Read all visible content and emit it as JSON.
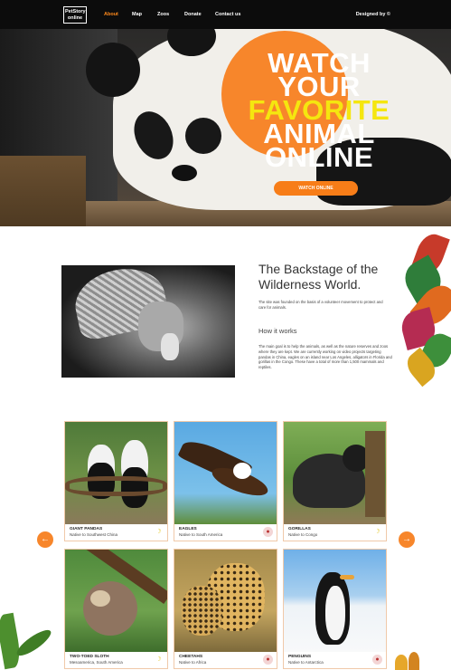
{
  "nav": {
    "logo_line1": "PetStory",
    "logo_line2": "online",
    "links": [
      "About",
      "Map",
      "Zoos",
      "Donate",
      "Contact us"
    ],
    "active": "About",
    "designed_by": "Designed by ©"
  },
  "hero": {
    "line1": "WATCH",
    "line2": "YOUR",
    "line3": "FAVORITE",
    "line4": "ANIMAL",
    "line5": "ONLINE",
    "button": "WATCH ONLINE"
  },
  "about": {
    "title": "The Backstage of the Wilderness World.",
    "text": "The site was founded on the basis of a volunteer movement to protect and care for animals.",
    "how_title": "How it works",
    "how_text": "The main goal is to help the animals, as well as the nature reserves and zoos where they are kept. We are currently working on video projects targeting pandas in China, eagles on an island near Los Angeles, alligators in Florida and gorillas in the Congo. These have a total of more than 1,500 mammals and reptiles."
  },
  "animals": [
    {
      "name": "GIANT PANDAS",
      "native": "Native to Southwest China",
      "food": "banana-icon"
    },
    {
      "name": "EAGLES",
      "native": "Native to South America",
      "food": "meat-icon"
    },
    {
      "name": "GORILLAS",
      "native": "Native to Congo",
      "food": "banana-icon"
    },
    {
      "name": "TWO-TOED SLOTH",
      "native": "Mesoamerica, South America",
      "food": "banana-icon"
    },
    {
      "name": "CHEETAHS",
      "native": "Native to Africa",
      "food": "meat-icon"
    },
    {
      "name": "PENGUINS",
      "native": "Native to Antarctica",
      "food": "meat-icon"
    }
  ],
  "carousel": {
    "prev": "←",
    "next": "→"
  },
  "colors": {
    "accent": "#f7862b",
    "highlight": "#f5e60f",
    "nav": "#0c0c0c"
  }
}
